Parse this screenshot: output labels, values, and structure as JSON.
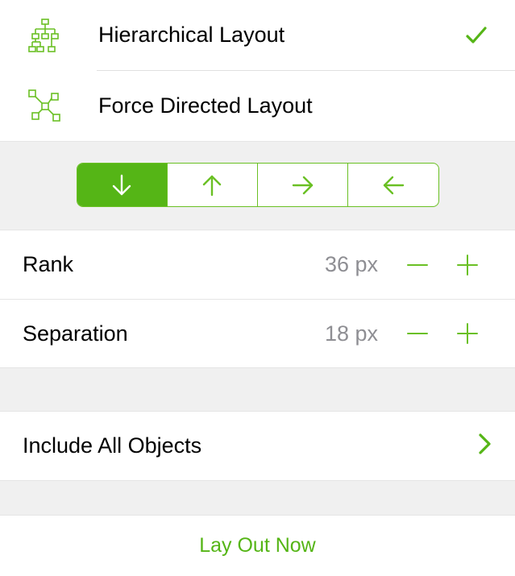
{
  "layouts": {
    "items": [
      {
        "label": "Hierarchical Layout",
        "selected": true
      },
      {
        "label": "Force Directed Layout",
        "selected": false
      }
    ]
  },
  "direction": {
    "selected_index": 0,
    "options": [
      "down",
      "up",
      "right",
      "left"
    ]
  },
  "spacing": {
    "rank": {
      "label": "Rank",
      "value": "36 px"
    },
    "separation": {
      "label": "Separation",
      "value": "18 px"
    }
  },
  "include": {
    "label": "Include All Objects"
  },
  "action": {
    "label": "Lay Out Now"
  },
  "colors": {
    "accent": "#55b516"
  }
}
